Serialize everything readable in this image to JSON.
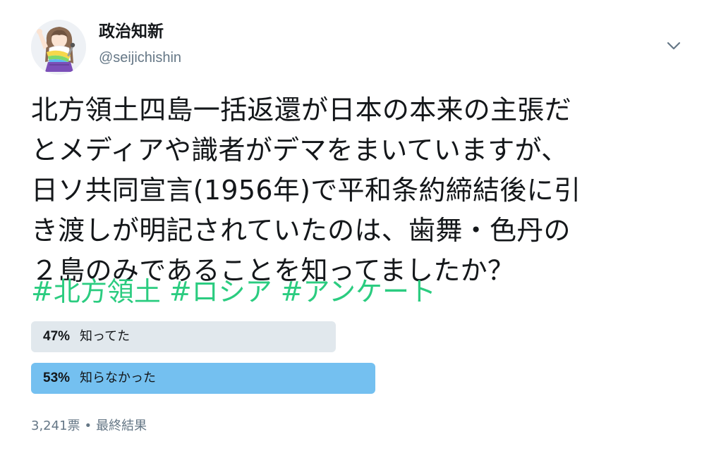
{
  "author": {
    "display_name": "政治知新",
    "handle": "@seijichishin"
  },
  "tweet": {
    "text": "北方領土四島一括返還が日本の本来の主張だ\nとメディアや識者がデマをまいていますが、\n日ソ共同宣言(1956年)で平和条約締結後に引\nき渡しが明記されていたのは、歯舞・色丹の\n２島のみであることを知ってましたか？",
    "hashtags": [
      "#北方領土",
      "#ロシア",
      "#アンケート"
    ]
  },
  "poll": {
    "options": [
      {
        "percent_label": "47%",
        "percent": 47,
        "label": "知ってた",
        "winner": false
      },
      {
        "percent_label": "53%",
        "percent": 53,
        "label": "知らなかった",
        "winner": true
      }
    ],
    "votes": "3,241票",
    "separator": "•",
    "status": "最終結果"
  },
  "icons": {
    "menu": "chevron-down-icon",
    "avatar": "anime-character-avatar"
  },
  "colors": {
    "hashtag": "#2bcc80",
    "winner_bar": "#74c0f0",
    "loser_bar": "#e1e8ed",
    "secondary_text": "#657786"
  }
}
